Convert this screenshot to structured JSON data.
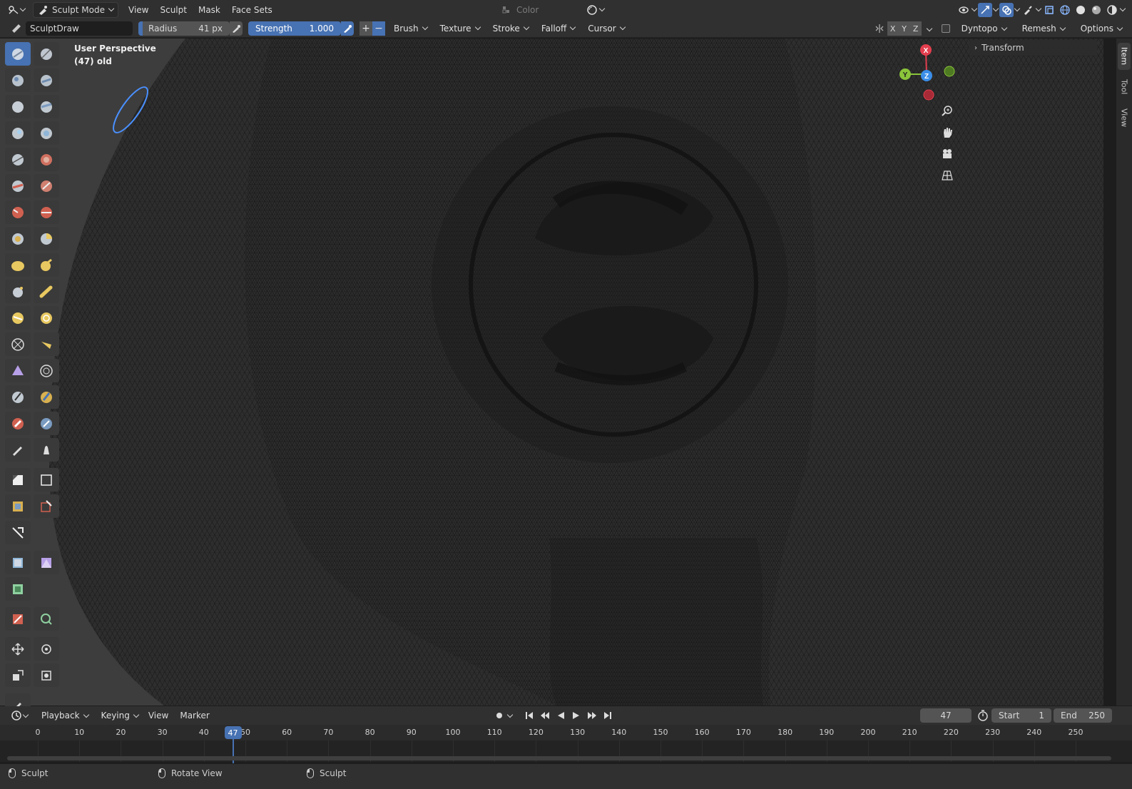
{
  "header": {
    "mode": "Sculpt Mode",
    "menus": [
      "View",
      "Sculpt",
      "Mask",
      "Face Sets"
    ],
    "color_dropdown": "Color"
  },
  "tool_settings": {
    "brush_name": "SculptDraw",
    "radius_label": "Radius",
    "radius_value": "41 px",
    "strength_label": "Strength",
    "strength_value": "1.000",
    "plus": "+",
    "minus": "−",
    "popovers": [
      "Brush",
      "Texture",
      "Stroke",
      "Falloff",
      "Cursor"
    ],
    "axes": [
      "X",
      "Y",
      "Z"
    ],
    "dyntopo": "Dyntopo",
    "remesh": "Remesh",
    "options": "Options"
  },
  "viewport": {
    "perspective": "User Perspective",
    "object": "(47) old",
    "gizmo_axes": {
      "x": "X",
      "y": "Y",
      "z": "Z"
    },
    "axis_colors": {
      "x": "#e33e4e",
      "y": "#8ac53a",
      "z": "#3b8ee9"
    }
  },
  "n_panel": {
    "transform": "Transform",
    "tabs": [
      "Item",
      "Tool",
      "View"
    ]
  },
  "timeline": {
    "menus": [
      "Playback",
      "Keying",
      "View",
      "Marker"
    ],
    "current_frame": "47",
    "start_label": "Start",
    "start_value": "1",
    "end_label": "End",
    "end_value": "250",
    "ticks": [
      "0",
      "10",
      "20",
      "30",
      "40",
      "50",
      "60",
      "70",
      "80",
      "90",
      "100",
      "110",
      "120",
      "130",
      "140",
      "150",
      "160",
      "170",
      "180",
      "190",
      "200",
      "210",
      "220",
      "230",
      "240",
      "250"
    ]
  },
  "status_bar": {
    "items": [
      "Sculpt",
      "Rotate View",
      "Sculpt"
    ]
  },
  "colors": {
    "accent": "#4772b3",
    "header_bg": "#303030",
    "viewport_bg": "#2b2b2b"
  }
}
